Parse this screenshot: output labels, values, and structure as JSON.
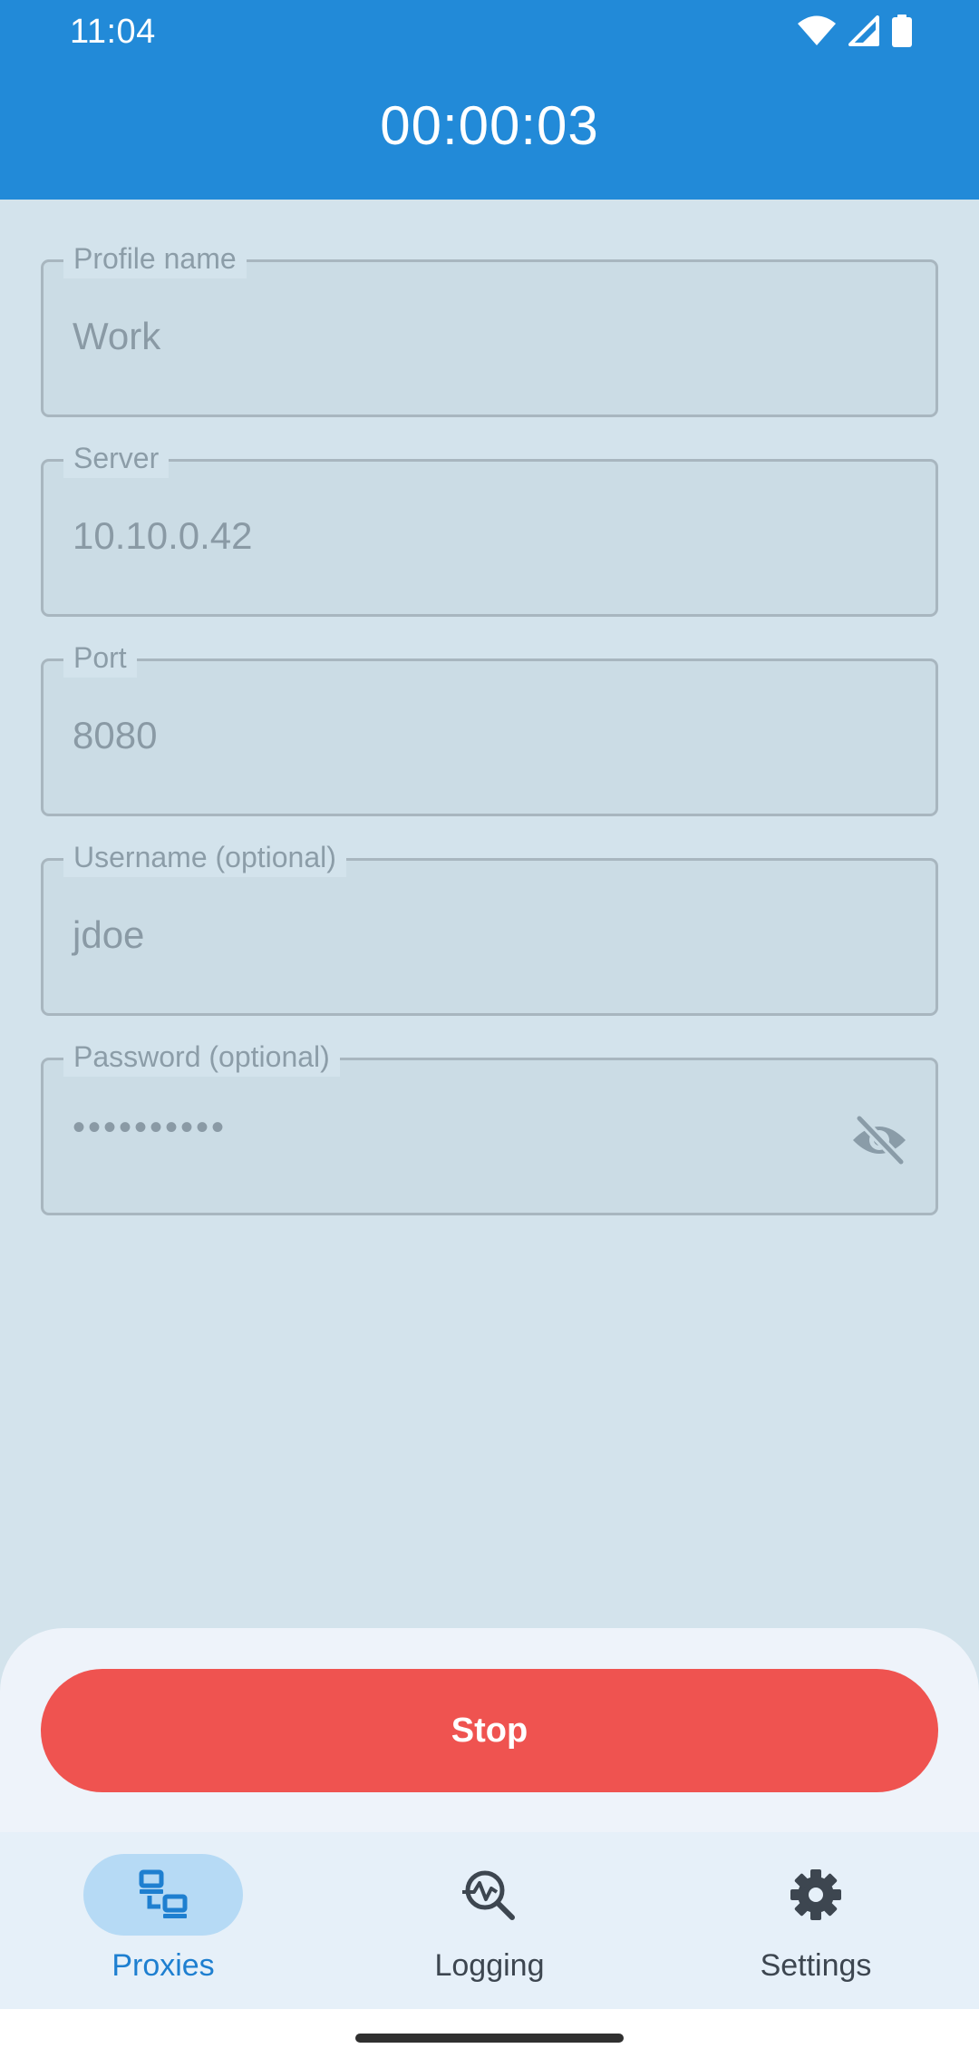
{
  "status_bar": {
    "time": "11:04",
    "icons": [
      "wifi-icon",
      "cellular-signal-icon",
      "battery-icon"
    ]
  },
  "header": {
    "timer": "00:00:03"
  },
  "form": {
    "profile_name": {
      "label": "Profile name",
      "value": "Work"
    },
    "server": {
      "label": "Server",
      "value": "10.10.0.42"
    },
    "port": {
      "label": "Port",
      "value": "8080"
    },
    "username": {
      "label": "Username (optional)",
      "value": "jdoe"
    },
    "password": {
      "label": "Password (optional)",
      "value": "••••••••••",
      "toggle_icon": "visibility-off-icon"
    }
  },
  "actions": {
    "stop_label": "Stop"
  },
  "bottom_nav": {
    "items": [
      {
        "label": "Proxies",
        "icon": "proxies-icon",
        "active": true
      },
      {
        "label": "Logging",
        "icon": "logging-icon",
        "active": false
      },
      {
        "label": "Settings",
        "icon": "settings-icon",
        "active": false
      }
    ]
  },
  "colors": {
    "app_bar": "#228ad8",
    "background": "#d3e3ec",
    "stop_button": "#ef5350",
    "nav_active": "#1e7fd0",
    "nav_active_pill": "#b6daf5"
  }
}
